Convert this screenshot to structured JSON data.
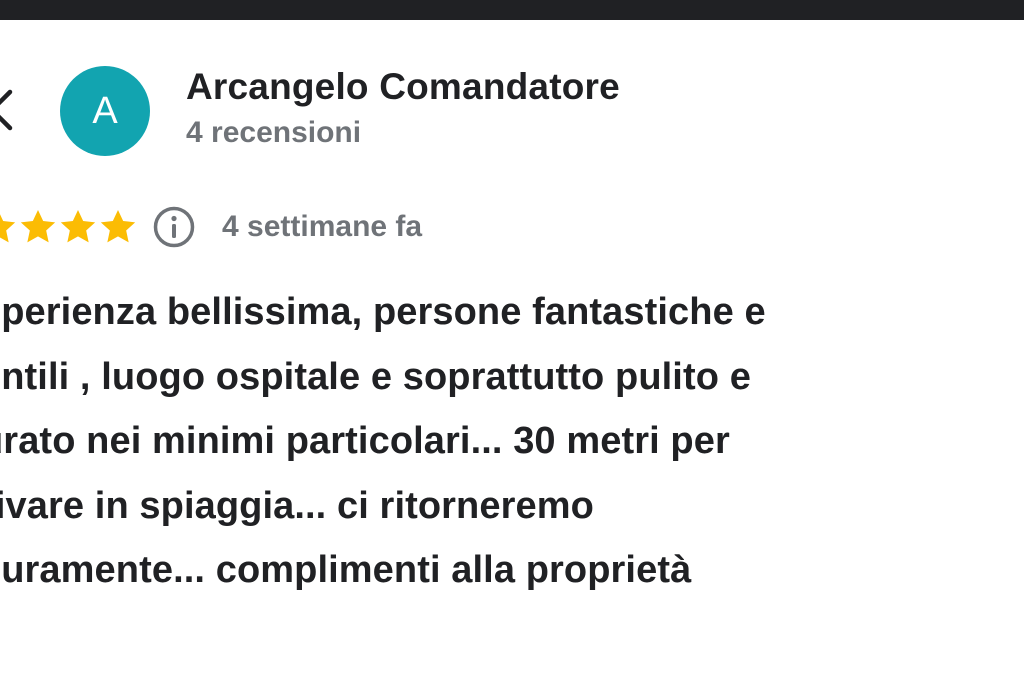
{
  "colors": {
    "avatar_bg": "#12a4b0",
    "star": "#fbbc04",
    "top_bar": "#202124",
    "text_primary": "#202124",
    "text_secondary": "#6f7378"
  },
  "header": {
    "back_icon": "chevron-left-icon"
  },
  "reviewer": {
    "avatar_letter": "A",
    "name": "Arcangelo Comandatore",
    "review_count": "4 recensioni"
  },
  "rating": {
    "stars": 5,
    "stars_visible_full": 4,
    "info_icon": "info-icon",
    "time_ago": "4 settimane fa"
  },
  "review": {
    "lines": [
      "sperienza bellissima, persone fantastiche e",
      "entili , luogo ospitale e soprattutto pulito e",
      "urato nei minimi particolari... 30 metri per",
      "rivare in spiaggia... ci ritorneremo",
      "curamente... complimenti alla proprietà"
    ]
  }
}
